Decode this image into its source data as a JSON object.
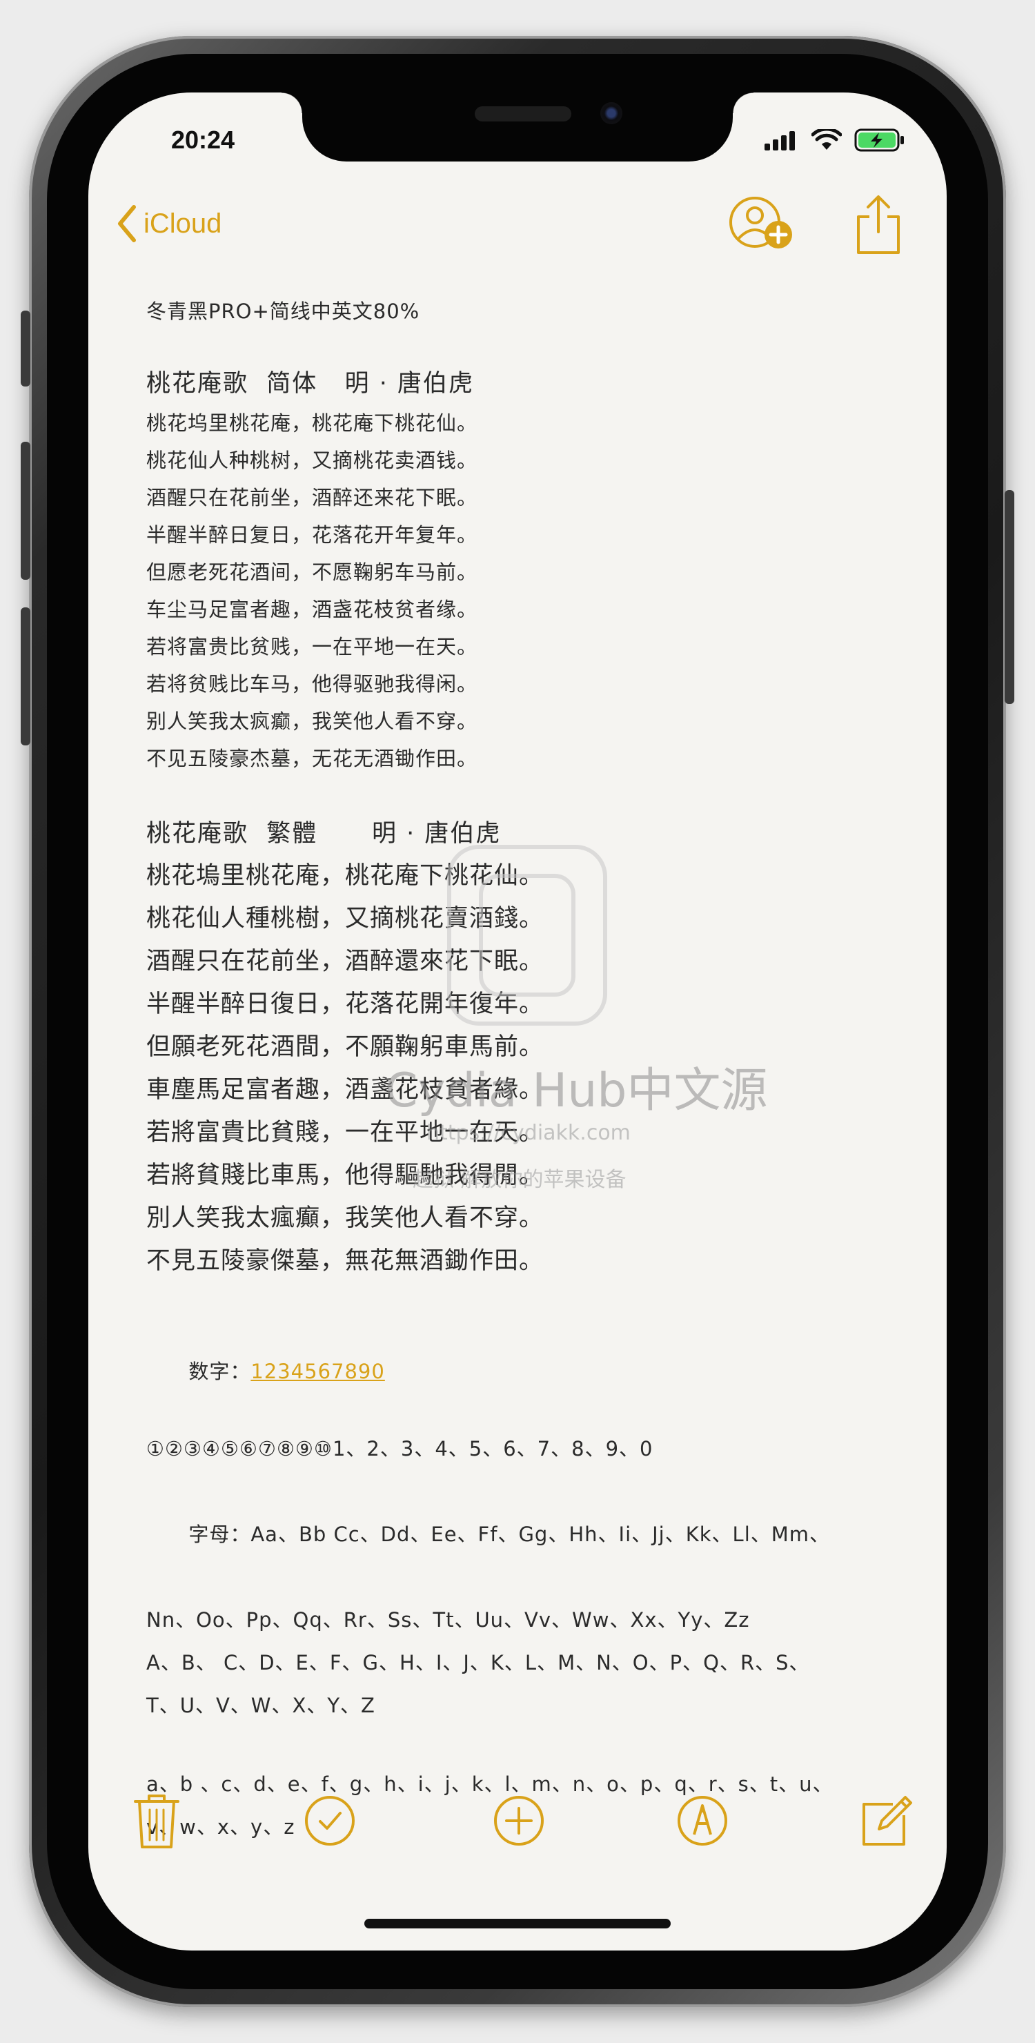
{
  "status": {
    "time": "20:24",
    "icons": [
      "cellular-signal-icon",
      "wifi-icon",
      "battery-charging-icon"
    ],
    "battery_color": "#4cd964"
  },
  "nav": {
    "back_label": "iCloud",
    "icons": [
      "add-person-icon",
      "share-icon"
    ],
    "accent_color": "#d9a21a"
  },
  "note": {
    "title": "冬青黑PRO+简线中英文80%",
    "section1": {
      "heading": "桃花庵歌  简体   明 · 唐伯虎",
      "lines": [
        "桃花坞里桃花庵，桃花庵下桃花仙。",
        "桃花仙人种桃树，又摘桃花卖酒钱。",
        "酒醒只在花前坐，酒醉还来花下眠。",
        "半醒半醉日复日，花落花开年复年。",
        "但愿老死花酒间，不愿鞠躬车马前。",
        "车尘马足富者趣，酒盏花枝贫者缘。",
        "若将富贵比贫贱，一在平地一在天。",
        "若将贫贱比车马，他得驱驰我得闲。",
        "别人笑我太疯癫，我笑他人看不穿。",
        "不见五陵豪杰墓，无花无酒锄作田。"
      ]
    },
    "section2": {
      "heading": "桃花庵歌  繁體      明 · 唐伯虎",
      "lines": [
        "桃花塢里桃花庵，桃花庵下桃花仙。",
        "桃花仙人種桃樹，又摘桃花賣酒錢。",
        "酒醒只在花前坐，酒醉還來花下眠。",
        "半醒半醉日復日，花落花開年復年。",
        "但願老死花酒間，不願鞠躬車馬前。",
        "車塵馬足富者趣，酒盞花枝貧者緣。",
        "若將富貴比貧賤，一在平地一在天。",
        "若將貧賤比車馬，他得驅馳我得閒。",
        "別人笑我太瘋癲，我笑他人看不穿。",
        "不見五陵豪傑墓，無花無酒鋤作田。"
      ]
    },
    "numbers_label": "数字：",
    "numbers_link": "1234567890",
    "circled_numbers": "①②③④⑤⑥⑦⑧⑨⑩1、2、3、4、5、6、7、8、9、0",
    "letters_label": "字母：",
    "letter_pairs_1": "Aa、Bb Cc、Dd、Ee、Ff、Gg、Hh、Ii、Jj、Kk、Ll、Mm、",
    "letter_pairs_2": "Nn、Oo、Pp、Qq、Rr、Ss、Tt、Uu、Vv、Ww、Xx、Yy、Zz",
    "upper_1": "A、B、 C、D、E、F、G、H、I、J、K、L、M、N、O、P、Q、R、S、",
    "upper_2": "T、U、V、W、X、Y、Z",
    "lower_1": "a、b 、c、d、e、f、g、h、i、j、k、l、m、n、o、p、q、r、s、t、u、",
    "lower_2": "v、w、x、y、z"
  },
  "watermark": {
    "title": "Cydia Hub中文源",
    "url": "https://cydiakk.com",
    "slogan": "越狱 解放你的苹果设备"
  },
  "toolbar": {
    "icons": [
      "trash-icon",
      "checklist-icon",
      "add-icon",
      "markup-icon",
      "compose-icon"
    ]
  }
}
